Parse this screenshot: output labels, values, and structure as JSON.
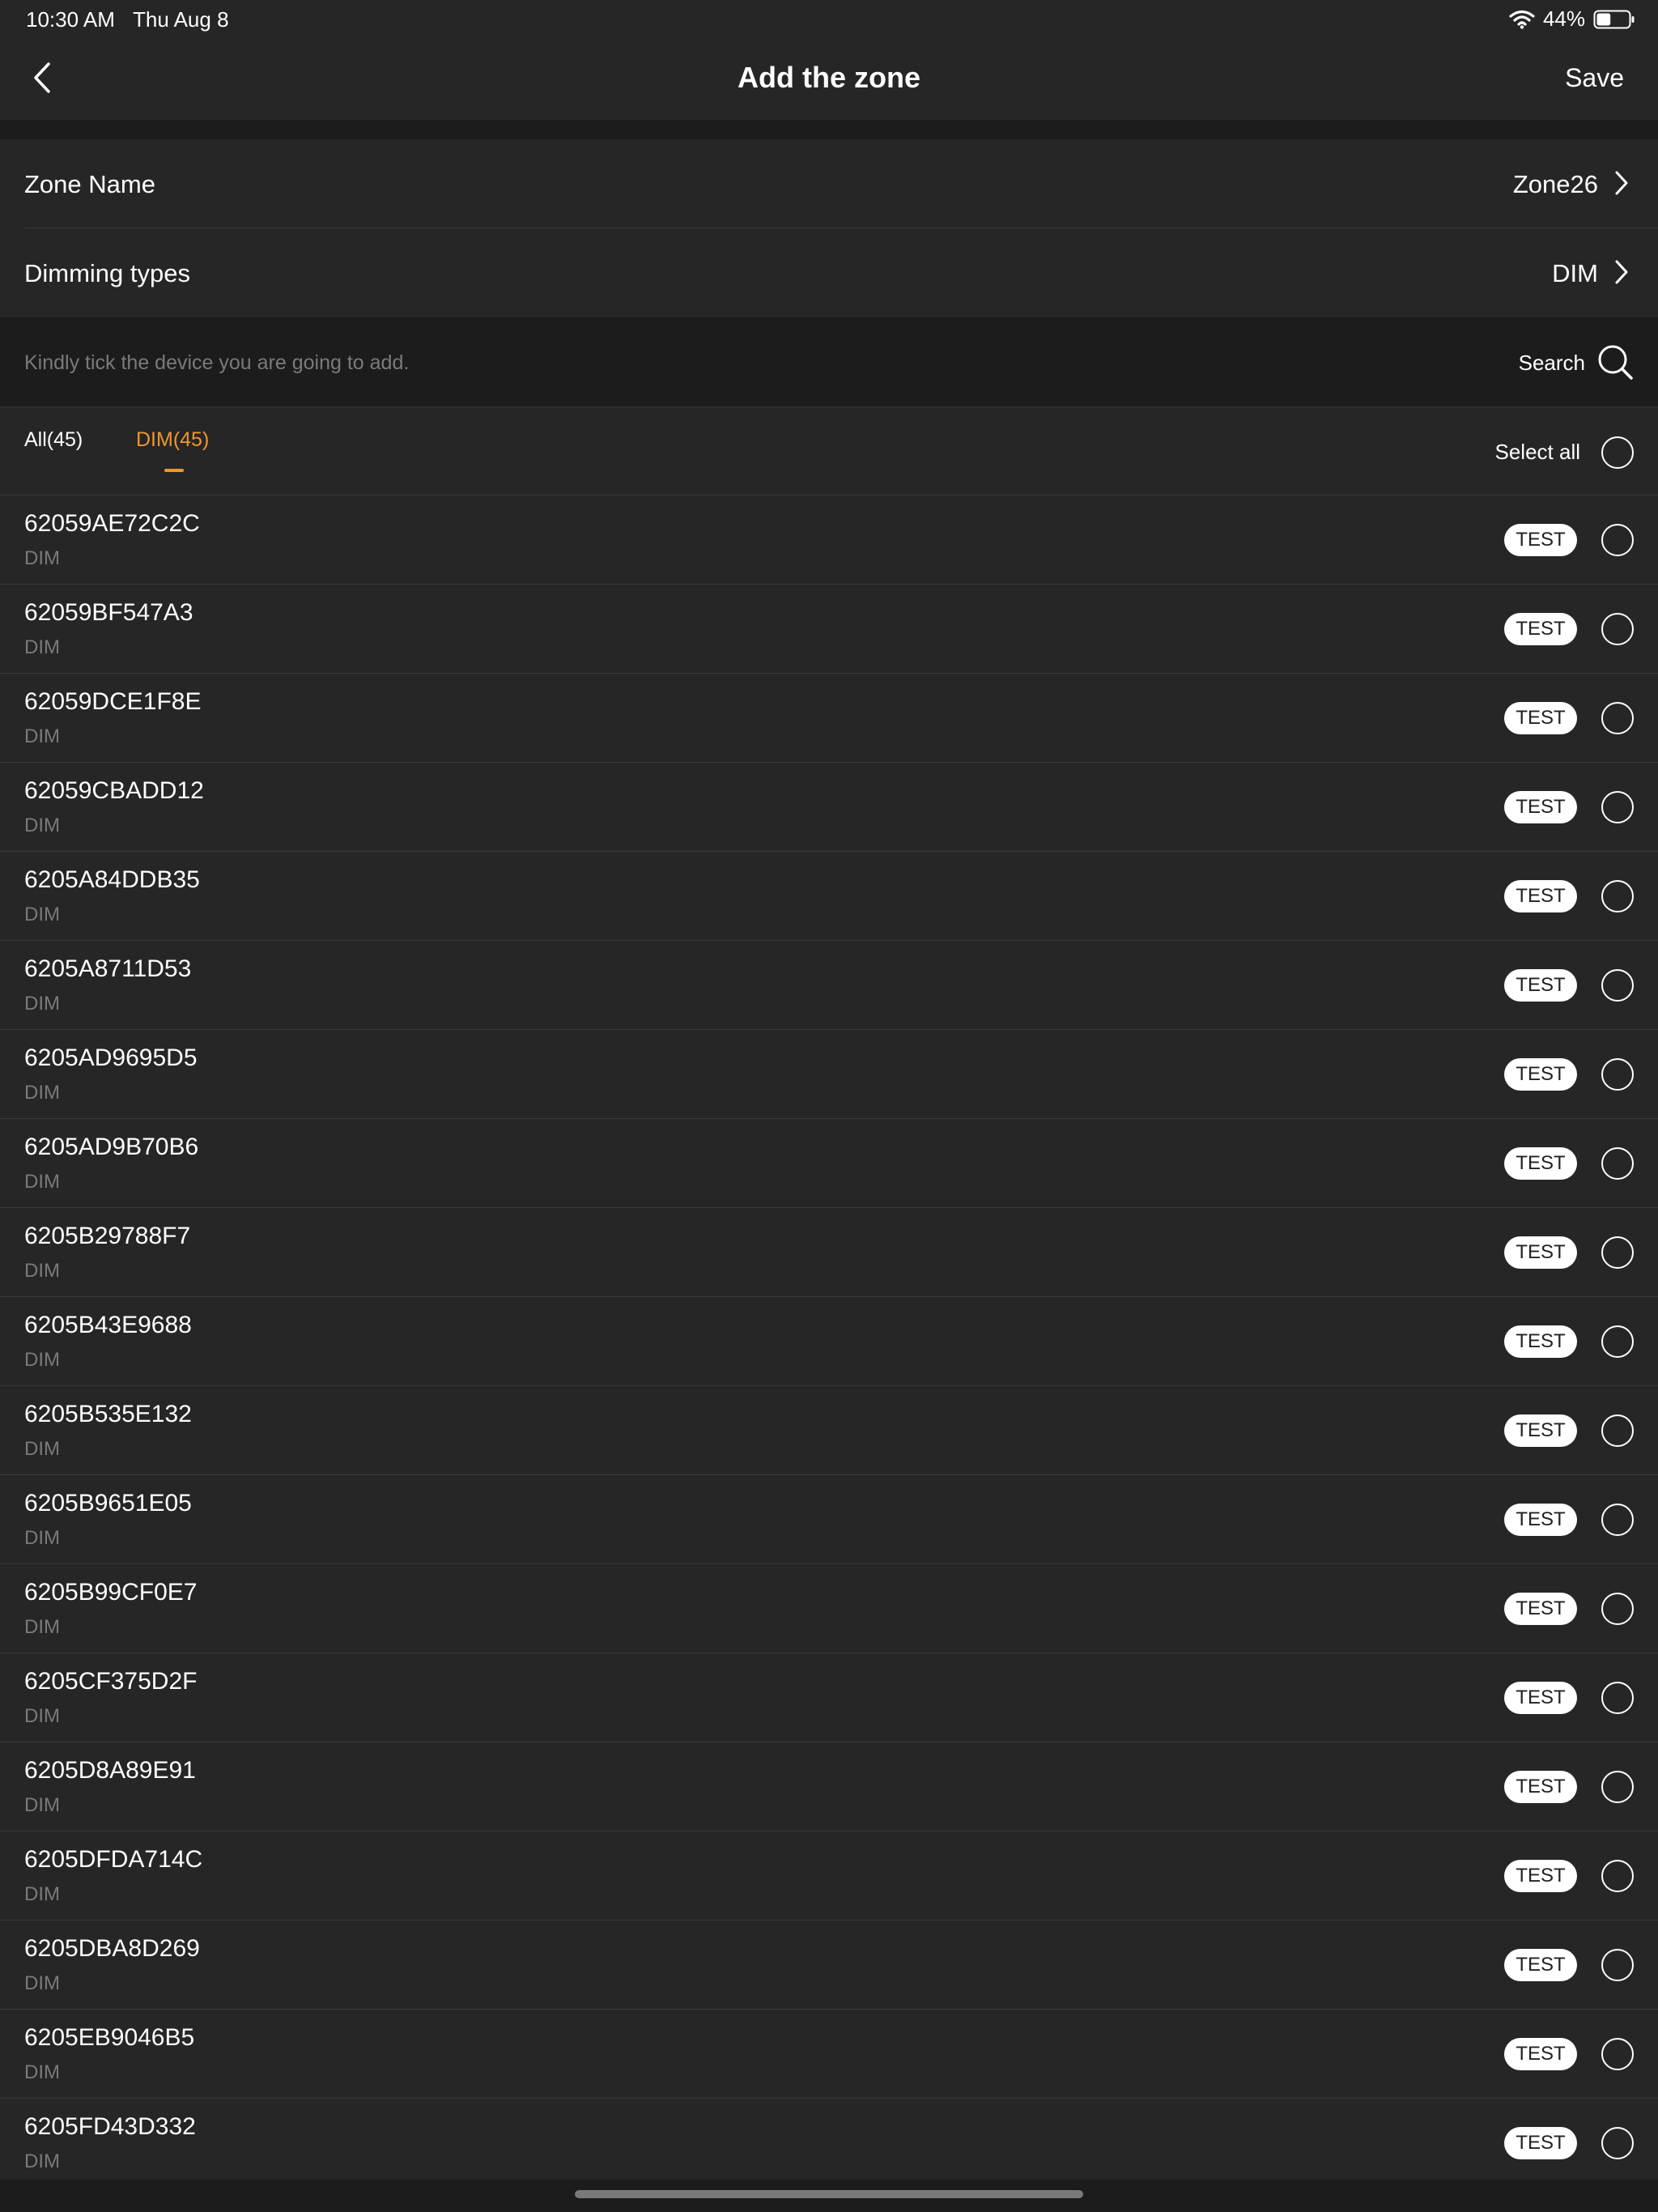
{
  "status_bar": {
    "time": "10:30 AM",
    "date": "Thu Aug 8",
    "battery": "44%",
    "battery_level": 0.44,
    "icons": [
      "wifi-icon",
      "battery-icon"
    ]
  },
  "header": {
    "title": "Add the zone",
    "save_label": "Save",
    "back_icon": "chevron-left-icon"
  },
  "settings": {
    "zone_name": {
      "label": "Zone Name",
      "value": "Zone26"
    },
    "dimming_types": {
      "label": "Dimming types",
      "value": "DIM"
    }
  },
  "hint": {
    "text": "Kindly tick the device you are going to add.",
    "search_label": "Search"
  },
  "tabs": {
    "all_label": "All(45)",
    "dim_label": "DIM(45)",
    "active": "DIM(45)",
    "select_all_label": "Select all"
  },
  "colors": {
    "accent": "#f0952e",
    "background": "#1c1c1c",
    "surface": "#262626",
    "muted_text": "#7a7a7a"
  },
  "devices": [
    {
      "id": "62059AE72C2C",
      "type": "DIM",
      "test_label": "TEST"
    },
    {
      "id": "62059BF547A3",
      "type": "DIM",
      "test_label": "TEST"
    },
    {
      "id": "62059DCE1F8E",
      "type": "DIM",
      "test_label": "TEST"
    },
    {
      "id": "62059CBADD12",
      "type": "DIM",
      "test_label": "TEST"
    },
    {
      "id": "6205A84DDB35",
      "type": "DIM",
      "test_label": "TEST"
    },
    {
      "id": "6205A8711D53",
      "type": "DIM",
      "test_label": "TEST"
    },
    {
      "id": "6205AD9695D5",
      "type": "DIM",
      "test_label": "TEST"
    },
    {
      "id": "6205AD9B70B6",
      "type": "DIM",
      "test_label": "TEST"
    },
    {
      "id": "6205B29788F7",
      "type": "DIM",
      "test_label": "TEST"
    },
    {
      "id": "6205B43E9688",
      "type": "DIM",
      "test_label": "TEST"
    },
    {
      "id": "6205B535E132",
      "type": "DIM",
      "test_label": "TEST"
    },
    {
      "id": "6205B9651E05",
      "type": "DIM",
      "test_label": "TEST"
    },
    {
      "id": "6205B99CF0E7",
      "type": "DIM",
      "test_label": "TEST"
    },
    {
      "id": "6205CF375D2F",
      "type": "DIM",
      "test_label": "TEST"
    },
    {
      "id": "6205D8A89E91",
      "type": "DIM",
      "test_label": "TEST"
    },
    {
      "id": "6205DFDA714C",
      "type": "DIM",
      "test_label": "TEST"
    },
    {
      "id": "6205DBA8D269",
      "type": "DIM",
      "test_label": "TEST"
    },
    {
      "id": "6205EB9046B5",
      "type": "DIM",
      "test_label": "TEST"
    },
    {
      "id": "6205FD43D332",
      "type": "DIM",
      "test_label": "TEST"
    }
  ]
}
